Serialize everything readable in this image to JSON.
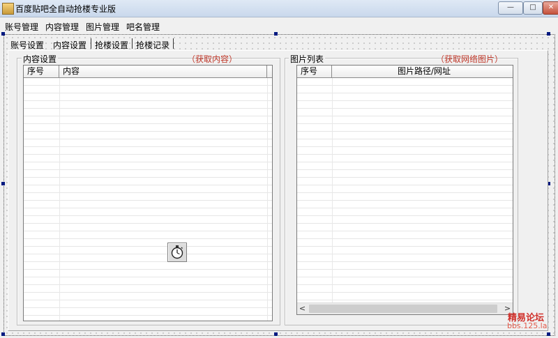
{
  "window": {
    "title": "百度贴吧全自动抢楼专业版",
    "min_glyph": "—",
    "max_glyph": "□",
    "close_glyph": "✕"
  },
  "menu": [
    "账号管理",
    "内容管理",
    "图片管理",
    "吧名管理"
  ],
  "tabs": [
    "账号设置",
    "内容设置",
    "抢楼设置",
    "抢楼记录"
  ],
  "content_group": {
    "title": "内容设置",
    "action": "（获取内容）",
    "columns": [
      "序号",
      "内容"
    ]
  },
  "image_group": {
    "title": "图片列表",
    "action": "（获取网络图片）",
    "columns": [
      "序号",
      "图片路径/网址"
    ],
    "scroll_left": "<",
    "scroll_right": ">"
  },
  "icons": [
    "app-icon",
    "stopwatch-icon"
  ],
  "colors": {
    "link": "#c0392b",
    "selection_handle": "#001a80"
  },
  "watermark": {
    "line1": "精易论坛",
    "line2": "bbs.125.la"
  }
}
